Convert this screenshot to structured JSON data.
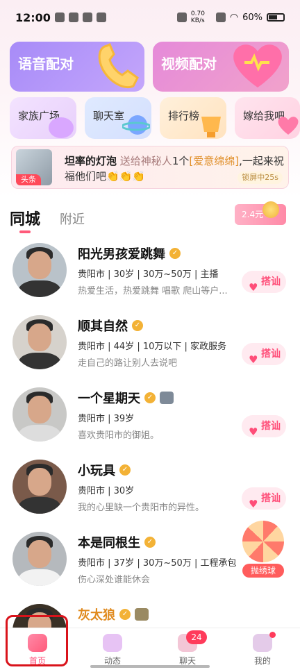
{
  "status_bar": {
    "time": "12:00",
    "net_speed": "0.70 KB/s",
    "battery": "60%"
  },
  "feature_cards": {
    "voice_match": "语音配对",
    "video_match": "视频配对",
    "family_plaza": "家族广场",
    "chat_room": "聊天室",
    "ranking": "排行榜",
    "marry_me": "嫁给我吧"
  },
  "announcement": {
    "badge": "头条",
    "sender": "坦率的灯泡",
    "action": "送给神秘人",
    "count": "1个",
    "gift": "[爱意绵绵]",
    "message": ",一起来祝福他们吧",
    "emoji": "👏👏👏",
    "lock_note": "锁屏中25s"
  },
  "tabs": {
    "active": "同城",
    "inactive": "附近"
  },
  "red_packet": {
    "amount": "2.4元"
  },
  "users": [
    {
      "name": "阳光男孩爱跳舞",
      "info": "贵阳市 | 30岁 | 30万~50万 | 主播",
      "bio": "热爱生活，热爱跳舞 唱歌 爬山等户...",
      "greet": "搭讪"
    },
    {
      "name": "顺其自然",
      "info": "贵阳市 | 44岁 | 10万以下 | 家政服务",
      "bio": "走自己的路让别人去说吧",
      "greet": "搭讪"
    },
    {
      "name": "一个星期天",
      "info": "贵阳市 | 39岁",
      "bio": "喜欢贵阳市的御姐。",
      "greet": "搭讪"
    },
    {
      "name": "小玩具",
      "info": "贵阳市 | 30岁",
      "bio": "我的心里缺一个贵阳市的异性。",
      "greet": "搭讪"
    },
    {
      "name": "本是同根生",
      "info": "贵阳市 | 37岁 | 30万~50万 | 工程承包",
      "bio": "伤心深处谁能休会",
      "greet": ""
    },
    {
      "name": "灰太狼",
      "info": "",
      "bio": "",
      "greet": ""
    }
  ],
  "float_ball": {
    "label": "抛绣球"
  },
  "nav": {
    "home": "首页",
    "dynamic": "动态",
    "chat": "聊天",
    "chat_badge": "24",
    "me": "我的"
  }
}
